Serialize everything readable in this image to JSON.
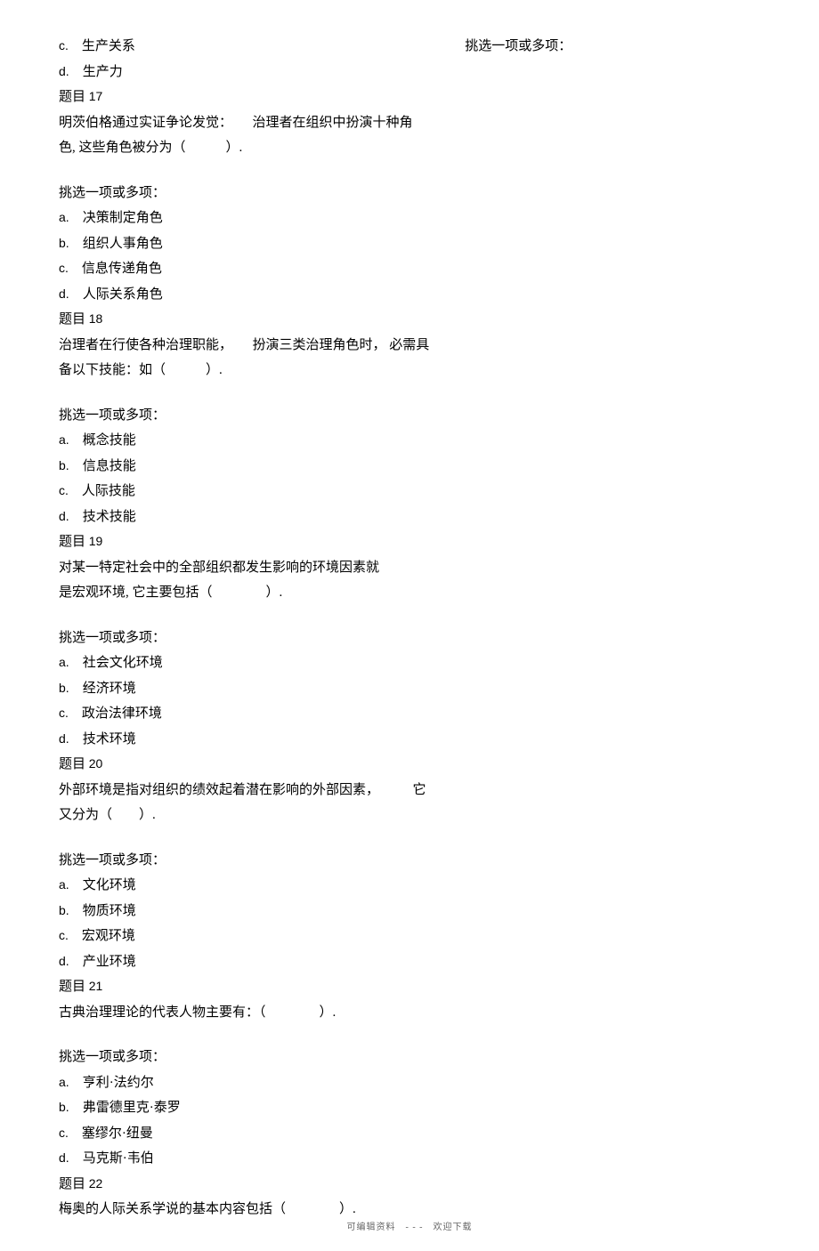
{
  "col_right_top": "挑选一项或多项：",
  "prior_options": {
    "c": "生产关系",
    "d": "生产力"
  },
  "q17": {
    "heading_prefix": "题目",
    "number": "17",
    "stem_line1": "明茨伯格通过实证争论发觉：　　治理者在组织中扮演十种角",
    "stem_line2": "色, 这些角色被分为（　　　）.",
    "select_label": "挑选一项或多项：",
    "a": "决策制定角色",
    "b": "组织人事角色",
    "c": "信息传递角色",
    "d": "人际关系角色"
  },
  "q18": {
    "heading_prefix": "题目",
    "number": "18",
    "stem_line1": "治理者在行使各种治理职能，　　扮演三类治理角色时，  必需具",
    "stem_line2": "备以下技能：如（　　　）.",
    "select_label": "挑选一项或多项：",
    "a": "概念技能",
    "b": "信息技能",
    "c": "人际技能",
    "d": "技术技能"
  },
  "q19": {
    "heading_prefix": "题目",
    "number": "19",
    "stem_line1": "对某一特定社会中的全部组织都发生影响的环境因素就",
    "stem_line2": "是宏观环境, 它主要包括（　　　　）.",
    "select_label": "挑选一项或多项：",
    "a": "社会文化环境",
    "b": "经济环境",
    "c": "政治法律环境",
    "d": "技术环境"
  },
  "q20": {
    "heading_prefix": "题目",
    "number": "20",
    "stem_line1": "外部环境是指对组织的绩效起着潜在影响的外部因素，　　　它",
    "stem_line2": "又分为（　　）.",
    "select_label": "挑选一项或多项：",
    "a": "文化环境",
    "b": "物质环境",
    "c": "宏观环境",
    "d": "产业环境"
  },
  "q21": {
    "heading_prefix": "题目",
    "number": "21",
    "stem_line1": "古典治理理论的代表人物主要有：（　　　　）.",
    "select_label": "挑选一项或多项：",
    "a": "亨利·法约尔",
    "b": "弗雷德里克·泰罗",
    "c": "塞缪尔·纽曼",
    "d": "马克斯·韦伯"
  },
  "q22": {
    "heading_prefix": "题目",
    "number": "22",
    "stem_line1": "梅奥的人际关系学说的基本内容包括（　　　　）."
  },
  "footer": "可编辑资料　- - -　欢迎下载"
}
